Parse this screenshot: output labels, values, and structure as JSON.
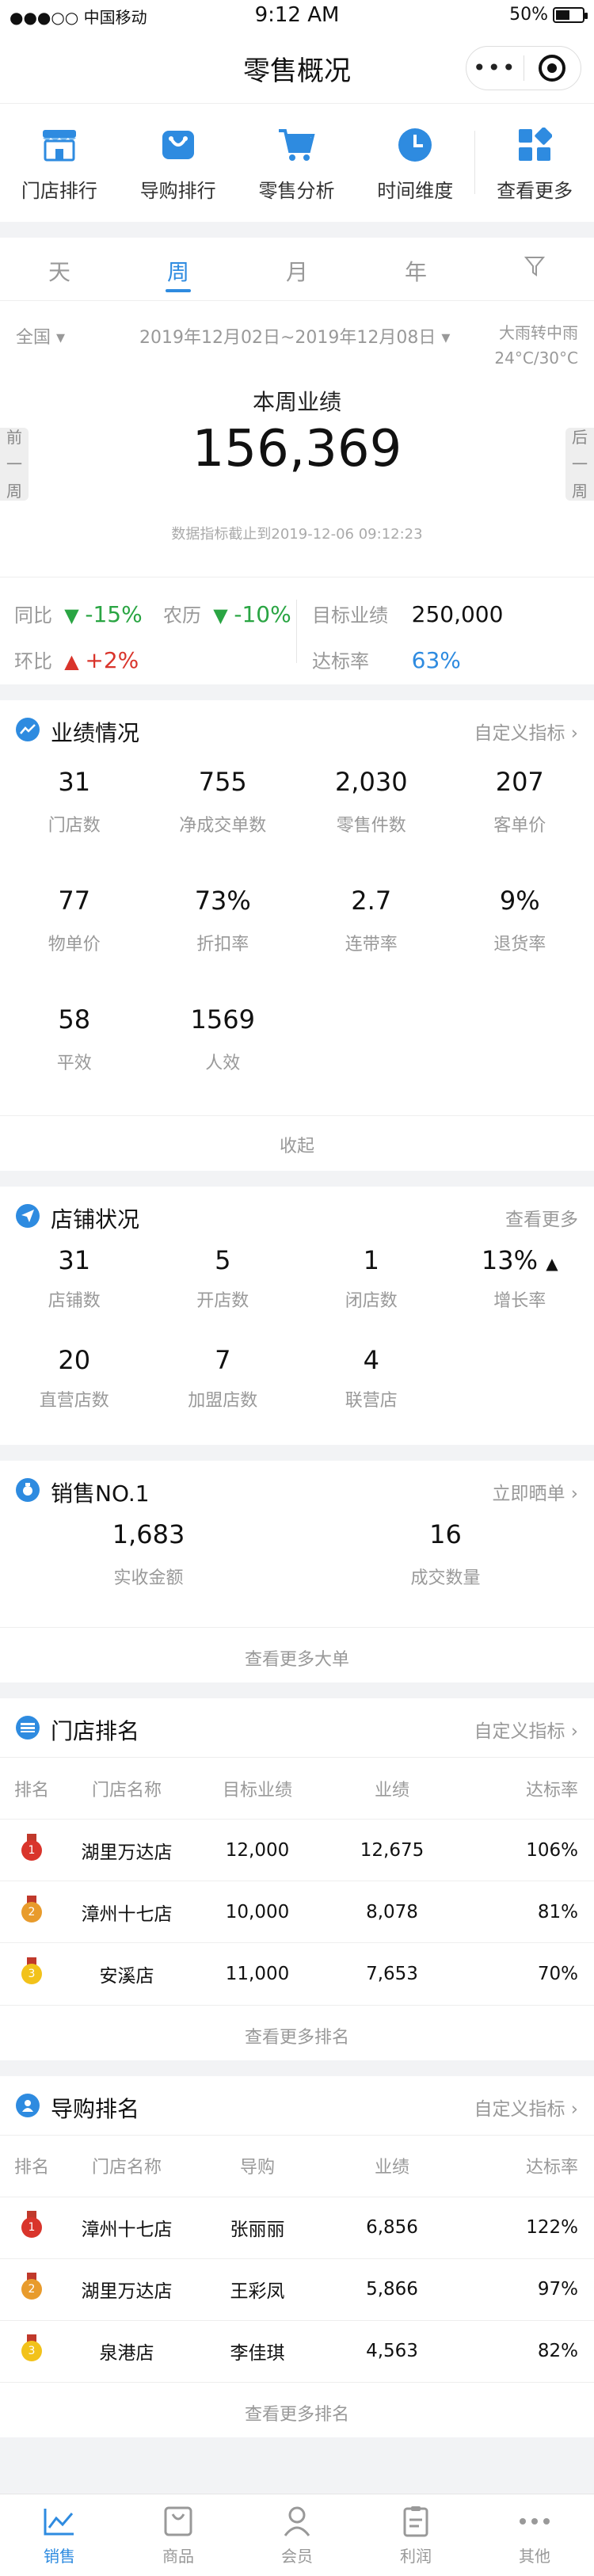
{
  "status": {
    "carrier": "●●●○○ 中国移动",
    "time": "9:12 AM",
    "battery": "50%"
  },
  "title": "零售概况",
  "quicknav": [
    {
      "label": "门店排行",
      "icon": "store-icon"
    },
    {
      "label": "导购排行",
      "icon": "guide-bag-icon"
    },
    {
      "label": "零售分析",
      "icon": "cart-icon"
    },
    {
      "label": "时间维度",
      "icon": "clock-icon"
    },
    {
      "label": "查看更多",
      "icon": "grid-more-icon"
    }
  ],
  "tabs": [
    "天",
    "周",
    "月",
    "年"
  ],
  "active_tab": "周",
  "summary": {
    "scope": "全国",
    "date_range": "2019年12月02日~2019年12月08日",
    "weather_line1": "大雨转中雨",
    "weather_line2": "24°C/30°C",
    "label": "本周业绩",
    "value": "156,369",
    "updated": "数据指标截止到2019-12-06  09:12:23",
    "prev": "前一周",
    "next": "后一周"
  },
  "compare": {
    "yoy_label": "同比",
    "yoy_value": "-15%",
    "lunar_label": "农历",
    "lunar_value": "-10%",
    "mom_label": "环比",
    "mom_value": "+2%",
    "target_label": "目标业绩",
    "target_value": "250,000",
    "rate_label": "达标率",
    "rate_value": "63%"
  },
  "performance": {
    "title": "业绩情况",
    "link": "自定义指标",
    "items": [
      {
        "value": "31",
        "label": "门店数"
      },
      {
        "value": "755",
        "label": "净成交单数"
      },
      {
        "value": "2,030",
        "label": "零售件数"
      },
      {
        "value": "207",
        "label": "客单价"
      },
      {
        "value": "77",
        "label": "物单价"
      },
      {
        "value": "73%",
        "label": "折扣率"
      },
      {
        "value": "2.7",
        "label": "连带率"
      },
      {
        "value": "9%",
        "label": "退货率"
      },
      {
        "value": "58",
        "label": "平效"
      },
      {
        "value": "1569",
        "label": "人效"
      }
    ],
    "collapse": "收起"
  },
  "stores": {
    "title": "店铺状况",
    "link": "查看更多",
    "items": [
      {
        "value": "31",
        "label": "店铺数"
      },
      {
        "value": "5",
        "label": "开店数"
      },
      {
        "value": "1",
        "label": "闭店数"
      },
      {
        "value": "13%",
        "label": "增长率"
      },
      {
        "value": "20",
        "label": "直营店数"
      },
      {
        "value": "7",
        "label": "加盟店数"
      },
      {
        "value": "4",
        "label": "联营店"
      }
    ]
  },
  "sales_no1": {
    "title": "销售NO.1",
    "link": "立即晒单",
    "items": [
      {
        "value": "1,683",
        "label": "实收金额"
      },
      {
        "value": "16",
        "label": "成交数量"
      }
    ],
    "more": "查看更多大单"
  },
  "store_rank": {
    "title": "门店排名",
    "link": "自定义指标",
    "headers": [
      "排名",
      "门店名称",
      "目标业绩",
      "业绩",
      "达标率"
    ],
    "rows": [
      {
        "rank": "1",
        "name": "湖里万达店",
        "target": "12,000",
        "sales": "12,675",
        "rate": "106%"
      },
      {
        "rank": "2",
        "name": "漳州十七店",
        "target": "10,000",
        "sales": "8,078",
        "rate": "81%"
      },
      {
        "rank": "3",
        "name": "安溪店",
        "target": "11,000",
        "sales": "7,653",
        "rate": "70%"
      }
    ],
    "more": "查看更多排名"
  },
  "guide_rank": {
    "title": "导购排名",
    "link": "自定义指标",
    "headers": [
      "排名",
      "门店名称",
      "导购",
      "业绩",
      "达标率"
    ],
    "rows": [
      {
        "rank": "1",
        "name": "漳州十七店",
        "guide": "张丽丽",
        "sales": "6,856",
        "rate": "122%"
      },
      {
        "rank": "2",
        "name": "湖里万达店",
        "guide": "王彩凤",
        "sales": "5,866",
        "rate": "97%"
      },
      {
        "rank": "3",
        "name": "泉港店",
        "guide": "李佳琪",
        "sales": "4,563",
        "rate": "82%"
      }
    ],
    "more": "查看更多排名"
  },
  "tabbar": [
    {
      "label": "销售",
      "icon": "chart-line-icon"
    },
    {
      "label": "商品",
      "icon": "shopping-bag-icon"
    },
    {
      "label": "会员",
      "icon": "user-icon"
    },
    {
      "label": "利润",
      "icon": "receipt-icon"
    },
    {
      "label": "其他",
      "icon": "more-dots-icon"
    }
  ],
  "colors": {
    "accent": "#2e8be0",
    "green": "#2aa543",
    "red": "#d9342b",
    "orange": "#e89b2c"
  }
}
